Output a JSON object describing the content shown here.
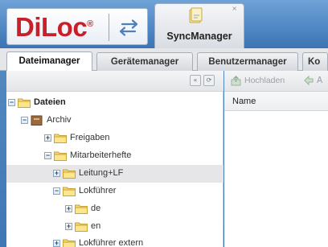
{
  "brand": {
    "logo_text": "DiLoc",
    "logo_mark": "®",
    "logo_color": "#c8202b",
    "swap_icon": "arrows-swap-icon"
  },
  "app_tab": {
    "label": "SyncManager",
    "close_glyph": "×",
    "icon": "sync-folder-icon"
  },
  "main_tabs": [
    {
      "label": "Dateimanager",
      "active": true
    },
    {
      "label": "Gerätemanager",
      "active": false
    },
    {
      "label": "Benutzermanager",
      "active": false
    },
    {
      "label": "Ko",
      "active": false
    }
  ],
  "tree_toolbar": {
    "collapse_glyph": "«",
    "refresh_glyph": "⟳"
  },
  "tree": [
    {
      "label": "Dateien",
      "expanded": true,
      "bold": true,
      "icon": "folder-icon"
    },
    {
      "label": "Archiv",
      "expanded": true,
      "icon": "archive-icon"
    },
    {
      "label": "Freigaben",
      "expanded": false,
      "icon": "folder-icon"
    },
    {
      "label": "Mitarbeiterhefte",
      "expanded": true,
      "icon": "folder-icon"
    },
    {
      "label": "Leitung+LF",
      "expanded": false,
      "icon": "folder-icon",
      "selected": true
    },
    {
      "label": "Lokführer",
      "expanded": true,
      "icon": "folder-icon"
    },
    {
      "label": "de",
      "expanded": false,
      "icon": "folder-icon"
    },
    {
      "label": "en",
      "expanded": false,
      "icon": "folder-icon"
    },
    {
      "label": "Lokführer extern",
      "expanded": false,
      "icon": "folder-icon"
    }
  ],
  "right_toolbar": {
    "upload_label": "Hochladen",
    "more_label": "A"
  },
  "file_table": {
    "columns": [
      "Name"
    ]
  }
}
